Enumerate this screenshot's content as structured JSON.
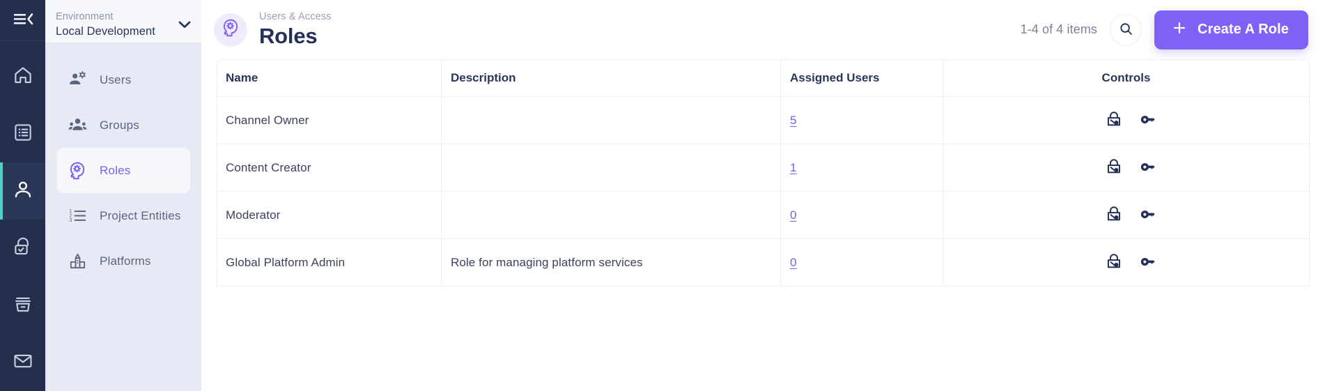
{
  "rail": {
    "menu_icon": "collapse-menu-icon",
    "items": [
      {
        "icon": "home-icon",
        "name": "home"
      },
      {
        "icon": "list-document-icon",
        "name": "content"
      },
      {
        "icon": "person-icon",
        "name": "users-access",
        "active": true
      },
      {
        "icon": "lock-check-icon",
        "name": "security"
      },
      {
        "icon": "archive-icon",
        "name": "archive"
      },
      {
        "icon": "envelope-icon",
        "name": "messages"
      }
    ]
  },
  "environment": {
    "label": "Environment",
    "value": "Local Development",
    "chevron_icon": "chevron-down-icon"
  },
  "subnav": {
    "items": [
      {
        "label": "Users",
        "icon": "user-settings-icon",
        "active": false
      },
      {
        "label": "Groups",
        "icon": "group-people-icon",
        "active": false
      },
      {
        "label": "Roles",
        "icon": "head-gear-icon",
        "active": true
      },
      {
        "label": "Project Entities",
        "icon": "numbered-list-icon",
        "active": false
      },
      {
        "label": "Platforms",
        "icon": "platform-building-icon",
        "active": false
      }
    ]
  },
  "header": {
    "icon": "head-gear-icon",
    "breadcrumb": "Users & Access",
    "title": "Roles",
    "item_count": "1-4 of 4 items",
    "search_icon": "search-icon",
    "create_label": "Create A Role",
    "plus_icon": "plus-icon"
  },
  "table": {
    "columns": [
      "Name",
      "Description",
      "Assigned Users",
      "Controls"
    ],
    "rows": [
      {
        "name": "Channel Owner",
        "description": "",
        "assigned": "5"
      },
      {
        "name": "Content Creator",
        "description": "",
        "assigned": "1"
      },
      {
        "name": "Moderator",
        "description": "",
        "assigned": "0"
      },
      {
        "name": "Global Platform Admin",
        "description": "Role for managing platform services",
        "assigned": "0"
      }
    ],
    "control_icons": [
      "padlock-permissions-icon",
      "key-icon"
    ]
  },
  "colors": {
    "rail_bg": "#242f4d",
    "subnav_bg": "#e7eaf4",
    "accent_purple": "#8061f5",
    "active_rail_marker": "#4fd1c5",
    "link_purple": "#7b5cf0",
    "title_navy": "#23305a"
  }
}
